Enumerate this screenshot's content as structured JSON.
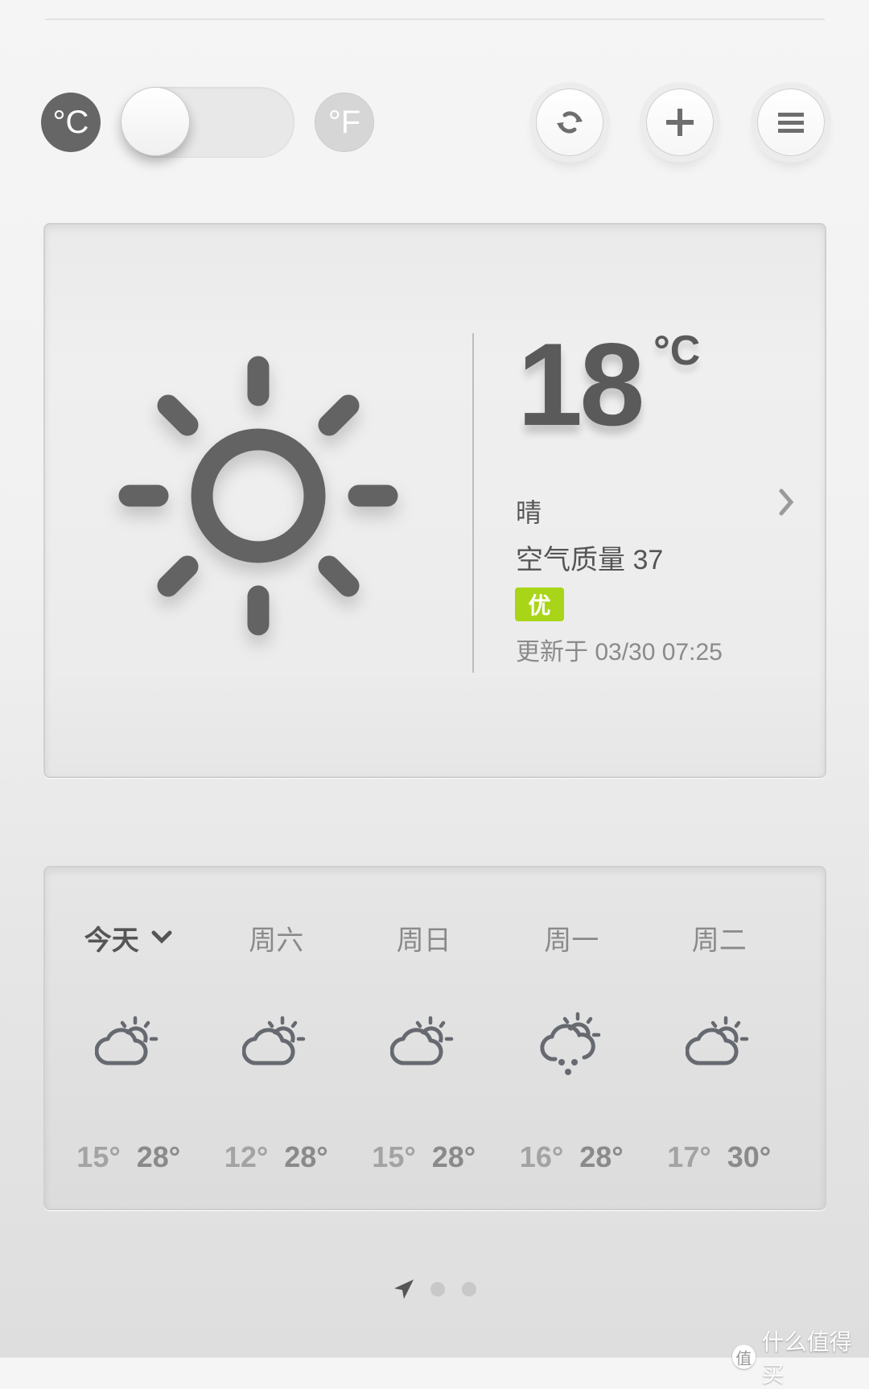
{
  "header": {
    "unit_celsius": "°C",
    "unit_fahrenheit": "°F",
    "unit_toggle_state": "celsius",
    "buttons": [
      {
        "name": "refresh",
        "icon": "refresh-icon"
      },
      {
        "name": "add-city",
        "icon": "plus-icon"
      },
      {
        "name": "menu",
        "icon": "menu-icon"
      }
    ]
  },
  "current": {
    "icon": "sun-icon",
    "temperature": "18",
    "unit": "°C",
    "condition": "晴",
    "aqi_label": "空气质量 37",
    "aqi_level": "优",
    "aqi_color": "#a8d517",
    "updated": "更新于 03/30 07:25"
  },
  "forecast": [
    {
      "day": "今天",
      "icon": "partly-cloudy-icon",
      "low": "15°",
      "high": "28°",
      "selected": true
    },
    {
      "day": "周六",
      "icon": "partly-cloudy-icon",
      "low": "12°",
      "high": "28°"
    },
    {
      "day": "周日",
      "icon": "partly-cloudy-icon",
      "low": "15°",
      "high": "28°"
    },
    {
      "day": "周一",
      "icon": "rain-sun-icon",
      "low": "16°",
      "high": "28°"
    },
    {
      "day": "周二",
      "icon": "partly-cloudy-icon",
      "low": "17°",
      "high": "30°"
    }
  ],
  "pager": {
    "pages": 3,
    "current": 0,
    "first_icon": "location-arrow-icon"
  },
  "watermark": {
    "logo": "值",
    "text": "什么值得买"
  }
}
